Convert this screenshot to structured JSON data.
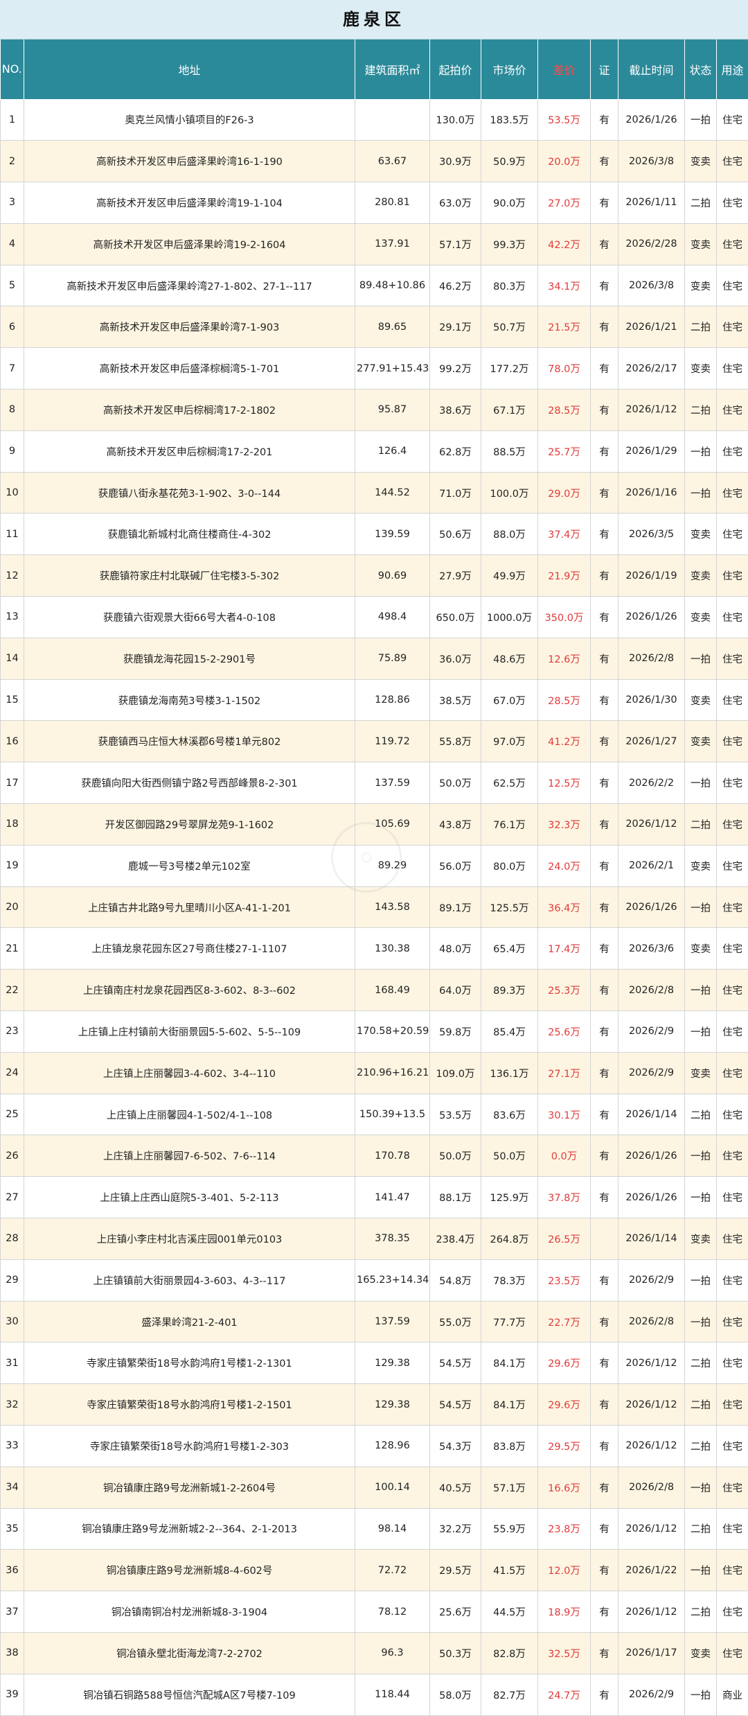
{
  "title": "鹿泉区",
  "headers": {
    "no": "NO.",
    "address": "地址",
    "area": "建筑面积㎡",
    "start_price": "起拍价",
    "market_price": "市场价",
    "diff": "差价",
    "cert": "证",
    "deadline": "截止时间",
    "status": "状态",
    "usage": "用途"
  },
  "colors": {
    "title_bg": "#dcedf3",
    "header_bg": "#2b8a9a",
    "diff_text": "#e23a3a",
    "alt_row_bg": "#fdf5e2"
  },
  "rows": [
    {
      "no": "1",
      "address": "奥克兰风情小镇项目的F26-3",
      "area": "",
      "start": "130.0万",
      "market": "183.5万",
      "diff": "53.5万",
      "cert": "有",
      "deadline": "2026/1/26",
      "status": "一拍",
      "usage": "住宅"
    },
    {
      "no": "2",
      "address": "高新技术开发区申后盛泽果岭湾16-1-190",
      "area": "63.67",
      "start": "30.9万",
      "market": "50.9万",
      "diff": "20.0万",
      "cert": "有",
      "deadline": "2026/3/8",
      "status": "变卖",
      "usage": "住宅"
    },
    {
      "no": "3",
      "address": "高新技术开发区申后盛泽果岭湾19-1-104",
      "area": "280.81",
      "start": "63.0万",
      "market": "90.0万",
      "diff": "27.0万",
      "cert": "有",
      "deadline": "2026/1/11",
      "status": "二拍",
      "usage": "住宅"
    },
    {
      "no": "4",
      "address": "高新技术开发区申后盛泽果岭湾19-2-1604",
      "area": "137.91",
      "start": "57.1万",
      "market": "99.3万",
      "diff": "42.2万",
      "cert": "有",
      "deadline": "2026/2/28",
      "status": "变卖",
      "usage": "住宅"
    },
    {
      "no": "5",
      "address": "高新技术开发区申后盛泽果岭湾27-1-802、27-1--117",
      "area": "89.48+10.86",
      "start": "46.2万",
      "market": "80.3万",
      "diff": "34.1万",
      "cert": "有",
      "deadline": "2026/3/8",
      "status": "变卖",
      "usage": "住宅"
    },
    {
      "no": "6",
      "address": "高新技术开发区申后盛泽果岭湾7-1-903",
      "area": "89.65",
      "start": "29.1万",
      "market": "50.7万",
      "diff": "21.5万",
      "cert": "有",
      "deadline": "2026/1/21",
      "status": "二拍",
      "usage": "住宅"
    },
    {
      "no": "7",
      "address": "高新技术开发区申后盛泽棕榈湾5-1-701",
      "area": "277.91+15.43",
      "start": "99.2万",
      "market": "177.2万",
      "diff": "78.0万",
      "cert": "有",
      "deadline": "2026/2/17",
      "status": "变卖",
      "usage": "住宅"
    },
    {
      "no": "8",
      "address": "高新技术开发区申后棕榈湾17-2-1802",
      "area": "95.87",
      "start": "38.6万",
      "market": "67.1万",
      "diff": "28.5万",
      "cert": "有",
      "deadline": "2026/1/12",
      "status": "二拍",
      "usage": "住宅"
    },
    {
      "no": "9",
      "address": "高新技术开发区申后棕榈湾17-2-201",
      "area": "126.4",
      "start": "62.8万",
      "market": "88.5万",
      "diff": "25.7万",
      "cert": "有",
      "deadline": "2026/1/29",
      "status": "一拍",
      "usage": "住宅"
    },
    {
      "no": "10",
      "address": "获鹿镇八街永基花苑3-1-902、3-0--144",
      "area": "144.52",
      "start": "71.0万",
      "market": "100.0万",
      "diff": "29.0万",
      "cert": "有",
      "deadline": "2026/1/16",
      "status": "一拍",
      "usage": "住宅"
    },
    {
      "no": "11",
      "address": "获鹿镇北新城村北商住楼商住-4-302",
      "area": "139.59",
      "start": "50.6万",
      "market": "88.0万",
      "diff": "37.4万",
      "cert": "有",
      "deadline": "2026/3/5",
      "status": "变卖",
      "usage": "住宅"
    },
    {
      "no": "12",
      "address": "获鹿镇符家庄村北联碱厂住宅楼3-5-302",
      "area": "90.69",
      "start": "27.9万",
      "market": "49.9万",
      "diff": "21.9万",
      "cert": "有",
      "deadline": "2026/1/19",
      "status": "变卖",
      "usage": "住宅"
    },
    {
      "no": "13",
      "address": "获鹿镇六街观景大街66号大者4-0-108",
      "area": "498.4",
      "start": "650.0万",
      "market": "1000.0万",
      "diff": "350.0万",
      "cert": "有",
      "deadline": "2026/1/26",
      "status": "变卖",
      "usage": "住宅"
    },
    {
      "no": "14",
      "address": "获鹿镇龙海花园15-2-2901号",
      "area": "75.89",
      "start": "36.0万",
      "market": "48.6万",
      "diff": "12.6万",
      "cert": "有",
      "deadline": "2026/2/8",
      "status": "一拍",
      "usage": "住宅"
    },
    {
      "no": "15",
      "address": "获鹿镇龙海南苑3号楼3-1-1502",
      "area": "128.86",
      "start": "38.5万",
      "market": "67.0万",
      "diff": "28.5万",
      "cert": "有",
      "deadline": "2026/1/30",
      "status": "变卖",
      "usage": "住宅"
    },
    {
      "no": "16",
      "address": "获鹿镇西马庄恒大林溪郡6号楼1单元802",
      "area": "119.72",
      "start": "55.8万",
      "market": "97.0万",
      "diff": "41.2万",
      "cert": "有",
      "deadline": "2026/1/27",
      "status": "变卖",
      "usage": "住宅"
    },
    {
      "no": "17",
      "address": "获鹿镇向阳大街西侧镇宁路2号西部峰景8-2-301",
      "area": "137.59",
      "start": "50.0万",
      "market": "62.5万",
      "diff": "12.5万",
      "cert": "有",
      "deadline": "2026/2/2",
      "status": "一拍",
      "usage": "住宅"
    },
    {
      "no": "18",
      "address": "开发区御园路29号翠屏龙苑9-1-1602",
      "area": "105.69",
      "start": "43.8万",
      "market": "76.1万",
      "diff": "32.3万",
      "cert": "有",
      "deadline": "2026/1/12",
      "status": "二拍",
      "usage": "住宅"
    },
    {
      "no": "19",
      "address": "鹿城一号3号楼2单元102室",
      "area": "89.29",
      "start": "56.0万",
      "market": "80.0万",
      "diff": "24.0万",
      "cert": "有",
      "deadline": "2026/2/1",
      "status": "变卖",
      "usage": "住宅"
    },
    {
      "no": "20",
      "address": "上庄镇古井北路9号九里晴川小区A-41-1-201",
      "area": "143.58",
      "start": "89.1万",
      "market": "125.5万",
      "diff": "36.4万",
      "cert": "有",
      "deadline": "2026/1/26",
      "status": "一拍",
      "usage": "住宅"
    },
    {
      "no": "21",
      "address": "上庄镇龙泉花园东区27号商住楼27-1-1107",
      "area": "130.38",
      "start": "48.0万",
      "market": "65.4万",
      "diff": "17.4万",
      "cert": "有",
      "deadline": "2026/3/6",
      "status": "变卖",
      "usage": "住宅"
    },
    {
      "no": "22",
      "address": "上庄镇南庄村龙泉花园西区8-3-602、8-3--602",
      "area": "168.49",
      "start": "64.0万",
      "market": "89.3万",
      "diff": "25.3万",
      "cert": "有",
      "deadline": "2026/2/8",
      "status": "一拍",
      "usage": "住宅"
    },
    {
      "no": "23",
      "address": "上庄镇上庄村镇前大街丽景园5-5-602、5-5--109",
      "area": "170.58+20.59",
      "start": "59.8万",
      "market": "85.4万",
      "diff": "25.6万",
      "cert": "有",
      "deadline": "2026/2/9",
      "status": "一拍",
      "usage": "住宅"
    },
    {
      "no": "24",
      "address": "上庄镇上庄丽馨园3-4-602、3-4--110",
      "area": "210.96+16.21",
      "start": "109.0万",
      "market": "136.1万",
      "diff": "27.1万",
      "cert": "有",
      "deadline": "2026/2/9",
      "status": "变卖",
      "usage": "住宅"
    },
    {
      "no": "25",
      "address": "上庄镇上庄丽馨园4-1-502/4-1--108",
      "area": "150.39+13.5",
      "start": "53.5万",
      "market": "83.6万",
      "diff": "30.1万",
      "cert": "有",
      "deadline": "2026/1/14",
      "status": "二拍",
      "usage": "住宅"
    },
    {
      "no": "26",
      "address": "上庄镇上庄丽馨园7-6-502、7-6--114",
      "area": "170.78",
      "start": "50.0万",
      "market": "50.0万",
      "diff": "0.0万",
      "cert": "有",
      "deadline": "2026/1/26",
      "status": "一拍",
      "usage": "住宅"
    },
    {
      "no": "27",
      "address": "上庄镇上庄西山庭院5-3-401、5-2-113",
      "area": "141.47",
      "start": "88.1万",
      "market": "125.9万",
      "diff": "37.8万",
      "cert": "有",
      "deadline": "2026/1/26",
      "status": "一拍",
      "usage": "住宅"
    },
    {
      "no": "28",
      "address": "上庄镇小李庄村北吉溪庄园001单元0103",
      "area": "378.35",
      "start": "238.4万",
      "market": "264.8万",
      "diff": "26.5万",
      "cert": "",
      "deadline": "2026/1/14",
      "status": "变卖",
      "usage": "住宅"
    },
    {
      "no": "29",
      "address": "上庄镇镇前大街丽景园4-3-603、4-3--117",
      "area": "165.23+14.34",
      "start": "54.8万",
      "market": "78.3万",
      "diff": "23.5万",
      "cert": "有",
      "deadline": "2026/2/9",
      "status": "一拍",
      "usage": "住宅"
    },
    {
      "no": "30",
      "address": "盛泽果岭湾21-2-401",
      "area": "137.59",
      "start": "55.0万",
      "market": "77.7万",
      "diff": "22.7万",
      "cert": "有",
      "deadline": "2026/2/8",
      "status": "一拍",
      "usage": "住宅"
    },
    {
      "no": "31",
      "address": "寺家庄镇繁荣街18号水韵鸿府1号楼1-2-1301",
      "area": "129.38",
      "start": "54.5万",
      "market": "84.1万",
      "diff": "29.6万",
      "cert": "有",
      "deadline": "2026/1/12",
      "status": "二拍",
      "usage": "住宅"
    },
    {
      "no": "32",
      "address": "寺家庄镇繁荣街18号水韵鸿府1号楼1-2-1501",
      "area": "129.38",
      "start": "54.5万",
      "market": "84.1万",
      "diff": "29.6万",
      "cert": "有",
      "deadline": "2026/1/12",
      "status": "二拍",
      "usage": "住宅"
    },
    {
      "no": "33",
      "address": "寺家庄镇繁荣街18号水韵鸿府1号楼1-2-303",
      "area": "128.96",
      "start": "54.3万",
      "market": "83.8万",
      "diff": "29.5万",
      "cert": "有",
      "deadline": "2026/1/12",
      "status": "二拍",
      "usage": "住宅"
    },
    {
      "no": "34",
      "address": "铜冶镇康庄路9号龙洲新城1-2-2604号",
      "area": "100.14",
      "start": "40.5万",
      "market": "57.1万",
      "diff": "16.6万",
      "cert": "有",
      "deadline": "2026/2/8",
      "status": "一拍",
      "usage": "住宅"
    },
    {
      "no": "35",
      "address": "铜冶镇康庄路9号龙洲新城2-2--364、2-1-2013",
      "area": "98.14",
      "start": "32.2万",
      "market": "55.9万",
      "diff": "23.8万",
      "cert": "有",
      "deadline": "2026/1/12",
      "status": "二拍",
      "usage": "住宅"
    },
    {
      "no": "36",
      "address": "铜冶镇康庄路9号龙洲新城8-4-602号",
      "area": "72.72",
      "start": "29.5万",
      "market": "41.5万",
      "diff": "12.0万",
      "cert": "有",
      "deadline": "2026/1/22",
      "status": "一拍",
      "usage": "住宅"
    },
    {
      "no": "37",
      "address": "铜冶镇南铜冶村龙洲新城8-3-1904",
      "area": "78.12",
      "start": "25.6万",
      "market": "44.5万",
      "diff": "18.9万",
      "cert": "有",
      "deadline": "2026/1/12",
      "status": "二拍",
      "usage": "住宅"
    },
    {
      "no": "38",
      "address": "铜冶镇永壁北街海龙湾7-2-2702",
      "area": "96.3",
      "start": "50.3万",
      "market": "82.8万",
      "diff": "32.5万",
      "cert": "有",
      "deadline": "2026/1/17",
      "status": "变卖",
      "usage": "住宅"
    },
    {
      "no": "39",
      "address": "铜冶镇石铜路588号恒信汽配城A区7号楼7-109",
      "area": "118.44",
      "start": "58.0万",
      "market": "82.7万",
      "diff": "24.7万",
      "cert": "有",
      "deadline": "2026/2/9",
      "status": "一拍",
      "usage": "商业"
    }
  ]
}
